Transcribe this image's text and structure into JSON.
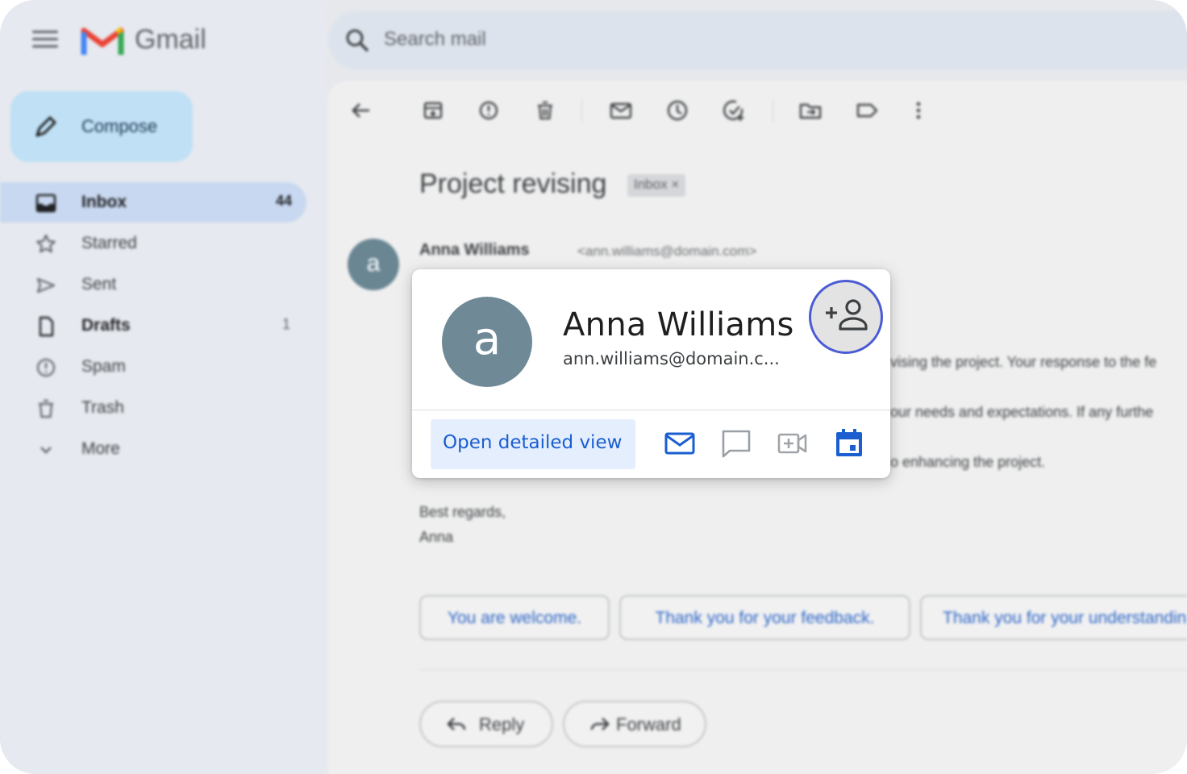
{
  "app": {
    "name": "Gmail"
  },
  "search": {
    "placeholder": "Search mail"
  },
  "compose": {
    "label": "Compose"
  },
  "nav": [
    {
      "label": "Inbox",
      "count": "44",
      "icon": "inbox-icon"
    },
    {
      "label": "Starred",
      "count": "",
      "icon": "star-icon"
    },
    {
      "label": "Sent",
      "count": "",
      "icon": "send-icon"
    },
    {
      "label": "Drafts",
      "count": "1",
      "icon": "draft-icon"
    },
    {
      "label": "Spam",
      "count": "",
      "icon": "spam-icon"
    },
    {
      "label": "Trash",
      "count": "",
      "icon": "trash-icon"
    },
    {
      "label": "More",
      "count": "",
      "icon": "chevron-down-icon"
    }
  ],
  "toolbar": {
    "icons": [
      "back-arrow-icon",
      "archive-icon",
      "report-spam-icon",
      "delete-icon",
      "mark-unread-icon",
      "snooze-icon",
      "add-task-icon",
      "move-to-icon",
      "label-icon",
      "more-vert-icon"
    ]
  },
  "email": {
    "subject": "Project revising",
    "label_chip": "Inbox",
    "chip_close": "×",
    "sender_initial": "a",
    "sender_name": "Anna Williams",
    "sender_email": "<ann.williams@domain.com>",
    "body_fragments": [
      "vising the project. Your response to the fe",
      "our needs and expectations. If any furthe",
      "o enhancing the project."
    ],
    "sign_off": "Best regards,",
    "signature": "Anna"
  },
  "smart_replies": [
    "You are welcome.",
    "Thank you for your feedback.",
    "Thank you for your understanding."
  ],
  "actions": {
    "reply": "Reply",
    "forward": "Forward"
  },
  "contact_card": {
    "initial": "a",
    "name": "Anna Williams",
    "email": "ann.williams@domain.c...",
    "open_detail_label": "Open detailed view",
    "icons": [
      "add-contact-icon",
      "email-icon",
      "chat-icon",
      "video-call-icon",
      "calendar-icon"
    ]
  },
  "colors": {
    "accent_blue": "#1a5ed0",
    "highlight_ring": "#4a5bd4",
    "avatar": "#6f8a96",
    "compose_bg": "#bfe0f5",
    "inbox_active": "#c8d8f0"
  }
}
